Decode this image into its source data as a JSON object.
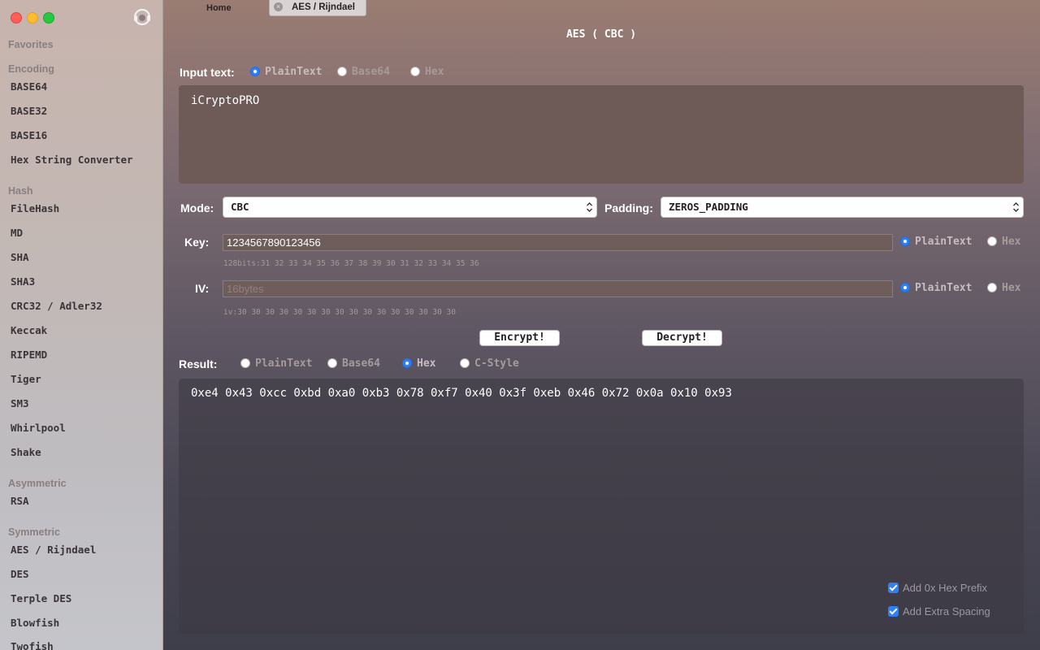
{
  "sidebar": {
    "sections": {
      "favorites": "Favorites",
      "encoding": "Encoding",
      "hash": "Hash",
      "asymmetric": "Asymmetric",
      "symmetric": "Symmetric"
    },
    "encoding_items": [
      "BASE64",
      "BASE32",
      "BASE16",
      "Hex String Converter"
    ],
    "hash_items": [
      "FileHash",
      "MD",
      "SHA",
      "SHA3",
      "CRC32 / Adler32",
      "Keccak",
      "RIPEMD",
      "Tiger",
      "SM3",
      "Whirlpool",
      "Shake"
    ],
    "asymmetric_items": [
      "RSA"
    ],
    "symmetric_items": [
      "AES / Rijndael",
      "DES",
      "Terple DES",
      "Blowfish",
      "Twofish"
    ]
  },
  "tabs": {
    "home": "Home",
    "active": "AES / Rijndael",
    "close_glyph": "×"
  },
  "title": "AES ( CBC )",
  "input": {
    "label": "Input text:",
    "formats": [
      "PlainText",
      "Base64",
      "Hex"
    ],
    "selected_format": "PlainText",
    "value": "iCryptoPRO"
  },
  "mode": {
    "label": "Mode:",
    "value": "CBC"
  },
  "padding": {
    "label": "Padding:",
    "value": "ZEROS_PADDING"
  },
  "key": {
    "label": "Key:",
    "value": "1234567890123456",
    "hint": "128bits:31 32 33 34 35 36 37 38 39 30 31 32 33 34 35 36",
    "formats": [
      "PlainText",
      "Hex"
    ],
    "selected_format": "PlainText"
  },
  "iv": {
    "label": "IV:",
    "placeholder": "16bytes",
    "hint": "iv:30 30 30 30 30 30 30 30 30 30 30 30 30 30 30 30",
    "formats": [
      "PlainText",
      "Hex"
    ],
    "selected_format": "PlainText"
  },
  "buttons": {
    "encrypt": "Encrypt!",
    "decrypt": "Decrypt!"
  },
  "result": {
    "label": "Result:",
    "formats": [
      "PlainText",
      "Base64",
      "Hex",
      "C-Style"
    ],
    "selected_format": "Hex",
    "value": "0xe4 0x43 0xcc 0xbd 0xa0 0xb3 0x78 0xf7 0x40 0x3f 0xeb 0x46 0x72 0x0a 0x10 0x93",
    "options": [
      {
        "label": "Add 0x Hex Prefix",
        "checked": true
      },
      {
        "label": "Add Extra Spacing",
        "checked": true
      }
    ]
  },
  "colors": {
    "accent": "#2f7ff5"
  },
  "icons": {
    "support": "headset-icon",
    "select": "chevron-updown-icon"
  }
}
